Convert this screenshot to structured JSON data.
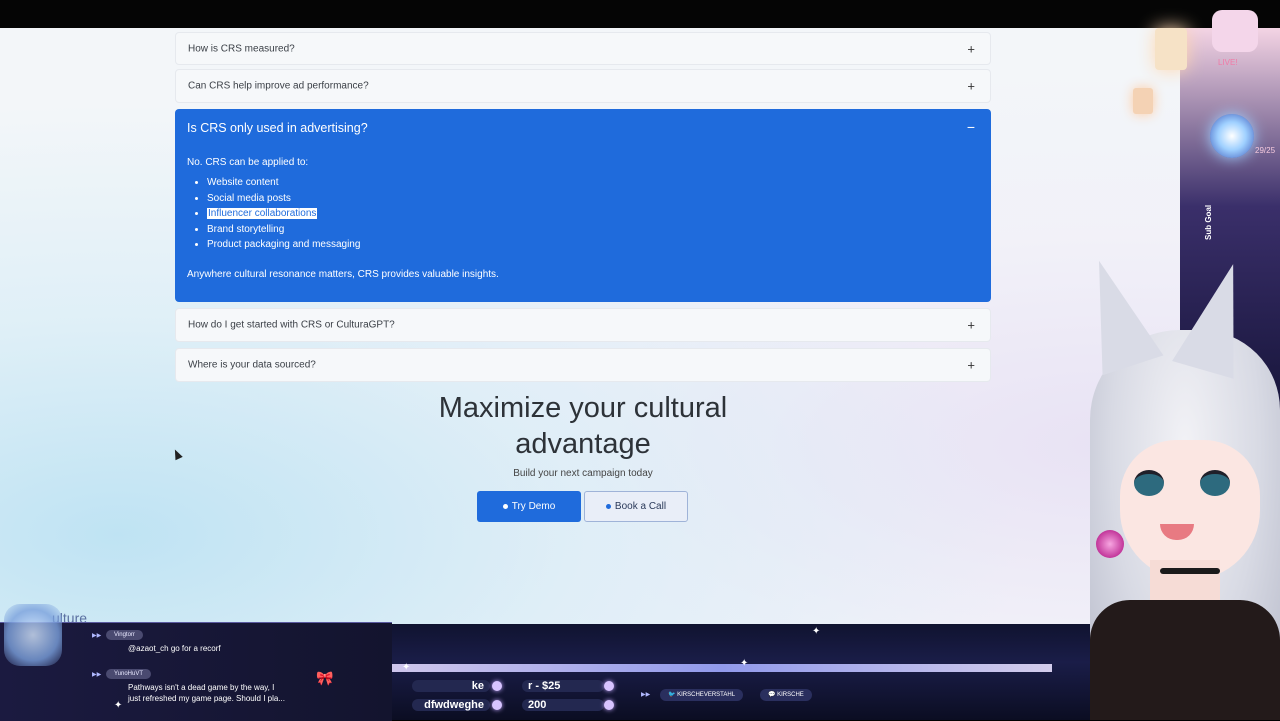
{
  "faq": {
    "items_top": [
      {
        "question": "How is CRS measured?",
        "icon": "+"
      },
      {
        "question": "Can CRS help improve ad performance?",
        "icon": "+"
      }
    ],
    "open_item": {
      "question": "Is CRS only used in advertising?",
      "icon": "−",
      "intro": "No. CRS can be applied to:",
      "list": [
        "Website content",
        "Social media posts",
        "Influencer collaborations",
        "Brand storytelling",
        "Product packaging and messaging"
      ],
      "outro": "Anywhere cultural resonance matters, CRS provides valuable insights."
    },
    "items_bottom": [
      {
        "question": "How do I get started with CRS or CulturaGPT?",
        "icon": "+"
      },
      {
        "question": "Where is your data sourced?",
        "icon": "+"
      }
    ]
  },
  "cta": {
    "title_line1": "Maximize your cultural",
    "title_line2": "advantage",
    "subtitle": "Build your next campaign today",
    "try_demo": "Try Demo",
    "book_call": "Book a Call"
  },
  "footer": {
    "logo_text": "ulture"
  },
  "overlay": {
    "live_label": "LIVE!",
    "sub_goal_label": "Sub Goal",
    "sub_count": "29/25",
    "chat": [
      {
        "user": "Vingtorr",
        "message": "@azaot_ch go for a recorf"
      },
      {
        "user": "YunoHuVT",
        "message": "Pathways isn't a dead game by the way, I"
      },
      {
        "user": "",
        "message": "just refreshed my game page. Should I pla..."
      }
    ],
    "ticker_left_top": "ke",
    "ticker_left_bottom": "dfwdweghe",
    "ticker_mid_top": "r - $25",
    "ticker_mid_bottom": "200",
    "social_twitter": "KIRSCHEVERSTAHL",
    "social_twitch": "KIRSCHE"
  },
  "colors": {
    "accent": "#1f6bdc",
    "page_bg": "#f3f6f9",
    "overlay_dark": "#1a1d48"
  }
}
